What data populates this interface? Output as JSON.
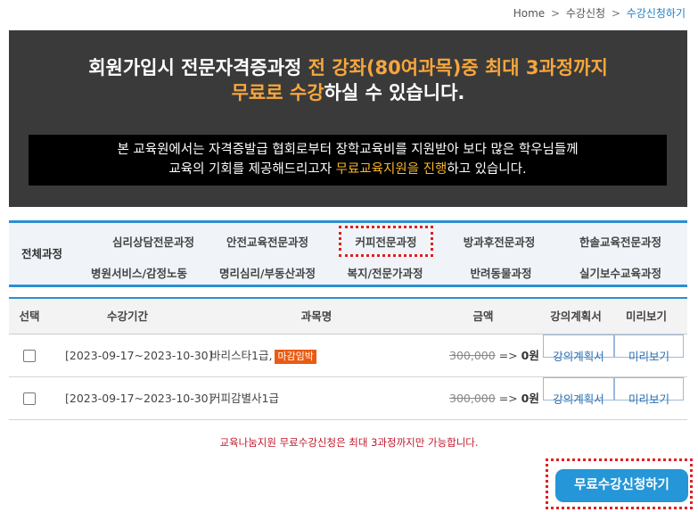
{
  "breadcrumb": {
    "home": "Home",
    "sep": ">",
    "level1": "수강신청",
    "current": "수강신청하기"
  },
  "banner": {
    "title_line1_a": "회원가입시 전문자격증과정 ",
    "title_line1_b": "전 강좌(80여과목)중 최대 3과정까지",
    "title_line2_a": "무료로 수강",
    "title_line2_b": "하실 수 있습니다.",
    "box_line1": "본 교육원에서는 자격증발급 협회로부터 장학교육비를 지원받아 보다 많은 학우님들께",
    "box_line2_a": "교육의 기회를 제공해드리고자 ",
    "box_line2_b": "무료교육지원을 진행",
    "box_line2_c": "하고 있습니다."
  },
  "categories": {
    "all": "전체과정",
    "row1": [
      "심리상담전문과정",
      "안전교육전문과정",
      "커피전문과정",
      "방과후전문과정",
      "한솔교육전문과정"
    ],
    "row2": [
      "병원서비스/감정노동",
      "명리심리/부동산과정",
      "복지/전문가과정",
      "반려동물과정",
      "실기보수교육과정"
    ]
  },
  "table": {
    "headers": {
      "select": "선택",
      "period": "수강기간",
      "subject": "과목명",
      "price": "금액",
      "plan": "강의계획서",
      "preview": "미리보기"
    },
    "rows": [
      {
        "period": "[2023-09-17~2023-10-30]",
        "subject": "바리스타1급,",
        "badge": "마감임박",
        "orig_price": "300,000",
        "arrow": "=>",
        "price": "0원",
        "plan": "강의계획서",
        "preview": "미리보기"
      },
      {
        "period": "[2023-09-17~2023-10-30]",
        "subject": "커피감별사1급",
        "badge": "",
        "orig_price": "300,000",
        "arrow": "=>",
        "price": "0원",
        "plan": "강의계획서",
        "preview": "미리보기"
      }
    ]
  },
  "notice": "교육나눔지원 무료수강신청은 최대 3과정까지만 가능합니다.",
  "apply_button": "무료수강신청하기",
  "colors": {
    "accent": "#2c8fd3",
    "highlight": "#f7a63c",
    "badge": "#ea5a12",
    "notice": "#c0172b",
    "button": "#2596d7"
  }
}
